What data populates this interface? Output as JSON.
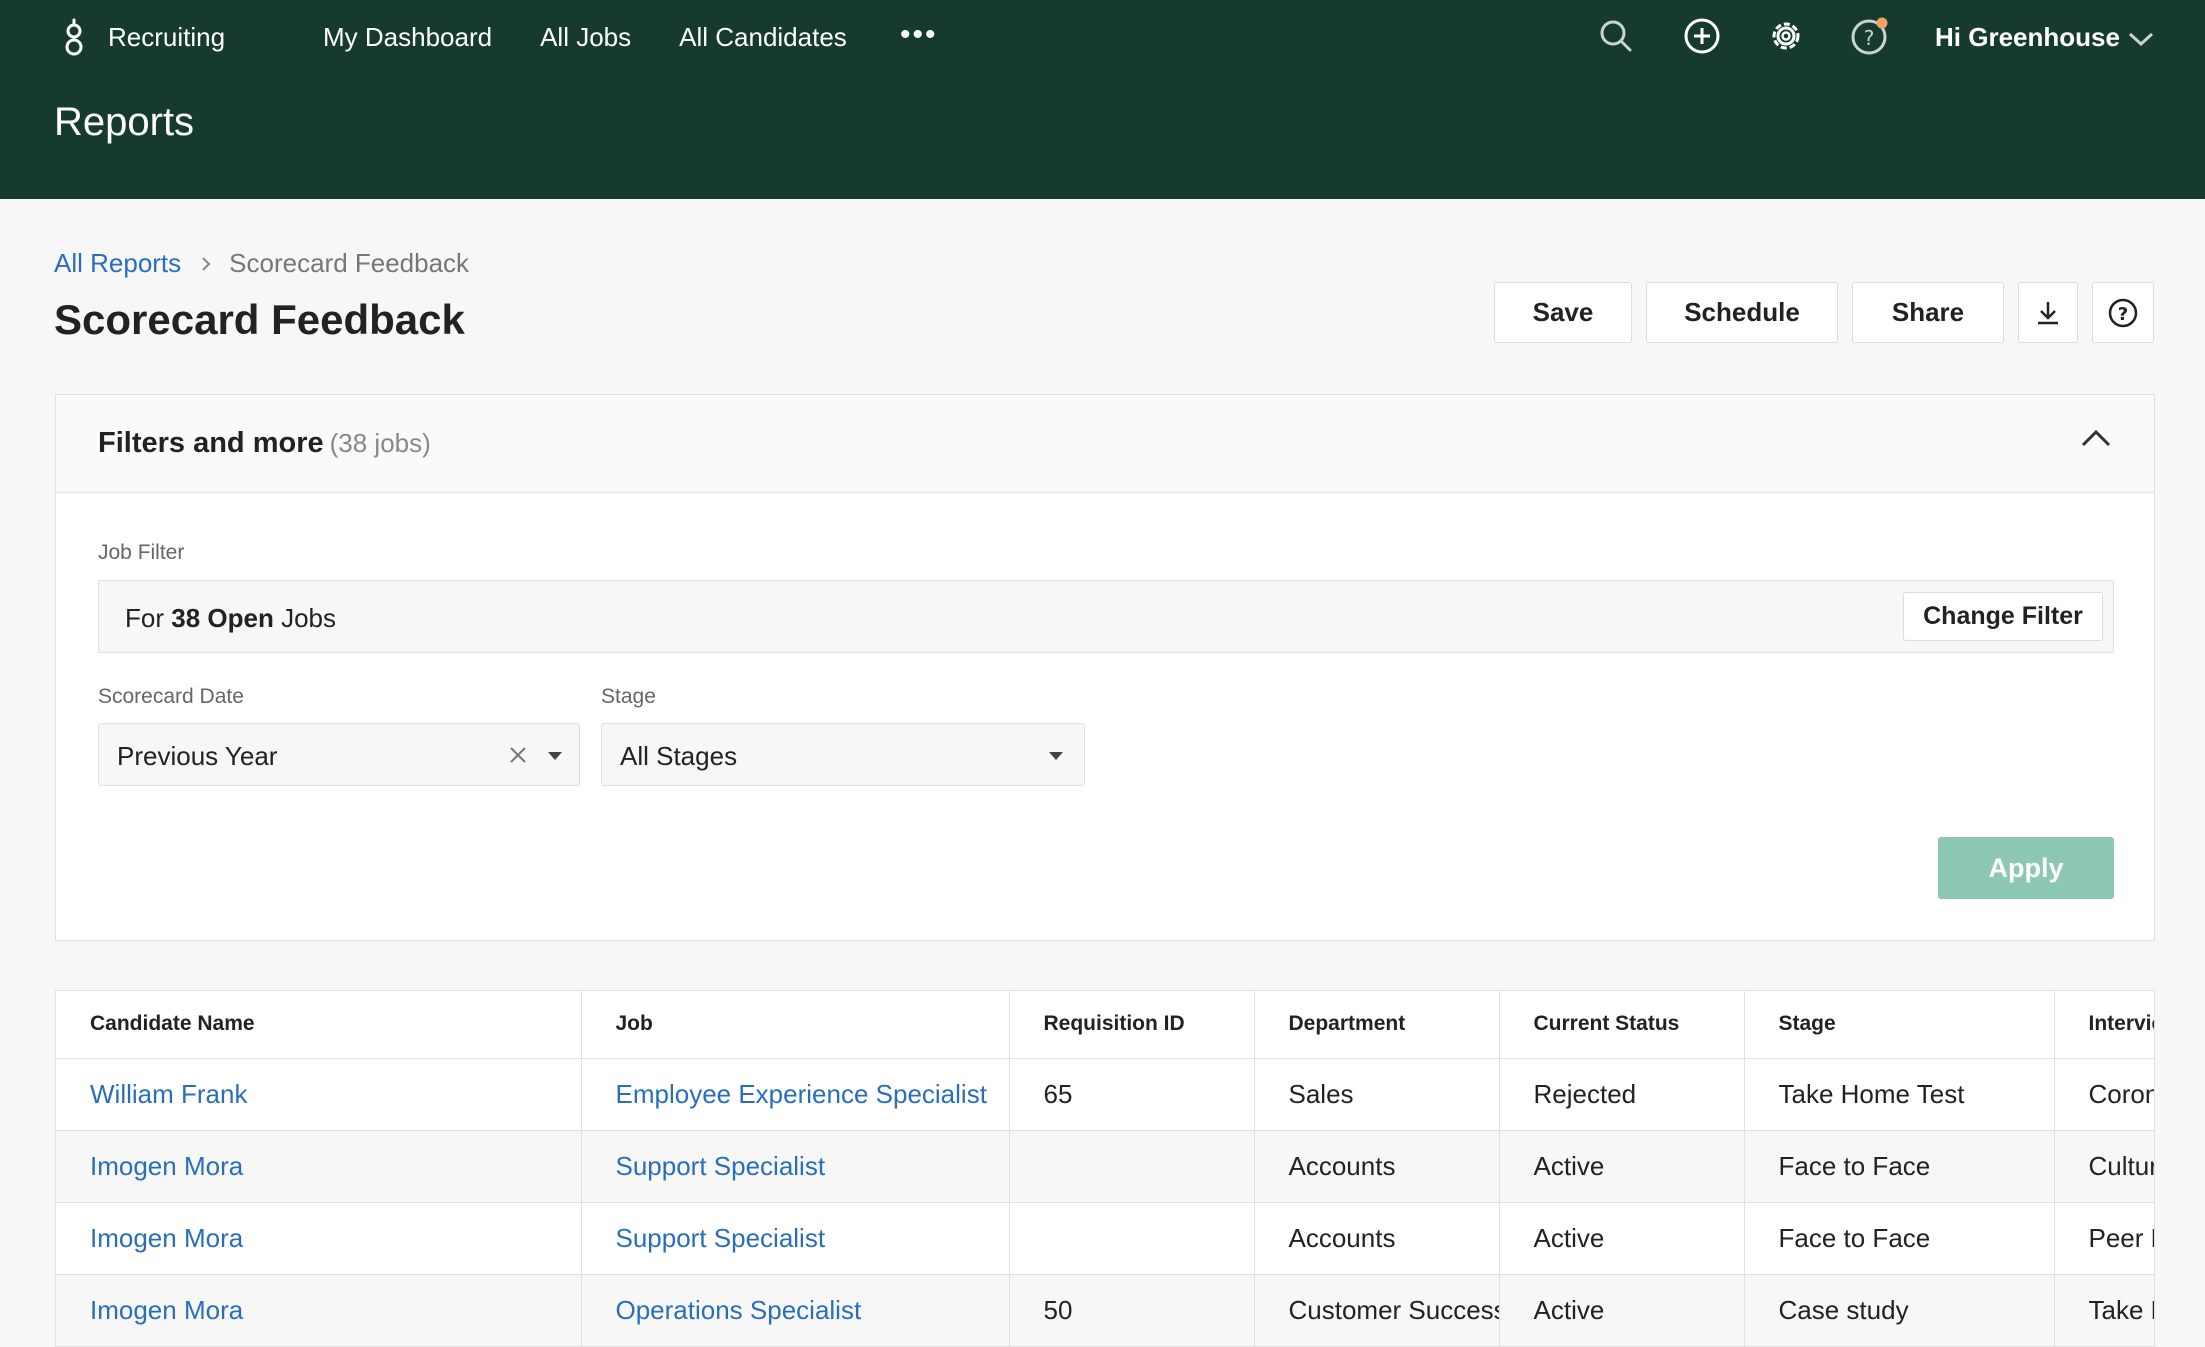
{
  "header": {
    "app_name": "Recruiting",
    "nav": [
      "My Dashboard",
      "All Jobs",
      "All Candidates"
    ],
    "more_label": "•••",
    "user_greeting": "Hi Greenhouse",
    "page_heading": "Reports",
    "icons": [
      "search-icon",
      "add-icon",
      "settings-icon",
      "help-icon"
    ],
    "colors": {
      "background": "#163b2e",
      "notification_dot": "#f4a261"
    }
  },
  "breadcrumb": {
    "parent": "All Reports",
    "current": "Scorecard Feedback"
  },
  "title": "Scorecard Feedback",
  "actions": {
    "save": "Save",
    "schedule": "Schedule",
    "share": "Share"
  },
  "filters": {
    "title": "Filters and more",
    "count": "(38 jobs)",
    "job_filter_label": "Job Filter",
    "job_filter_prefix": "For",
    "job_filter_bold": "38 Open",
    "job_filter_suffix": "Jobs",
    "change_filter": "Change Filter",
    "scorecard_date_label": "Scorecard Date",
    "scorecard_date_value": "Previous Year",
    "stage_label": "Stage",
    "stage_value": "All Stages",
    "apply": "Apply"
  },
  "table": {
    "columns": [
      "Candidate Name",
      "Job",
      "Requisition ID",
      "Department",
      "Current Status",
      "Stage",
      "Interview"
    ],
    "rows": [
      [
        "William Frank",
        "Employee Experience Specialist",
        "65",
        "Sales",
        "Rejected",
        "Take Home Test",
        "Coronavirus"
      ],
      [
        "Imogen Mora",
        "Support Specialist",
        "",
        "Accounts",
        "Active",
        "Face to Face",
        "Culture"
      ],
      [
        "Imogen Mora",
        "Support Specialist",
        "",
        "Accounts",
        "Active",
        "Face to Face",
        "Peer Review"
      ],
      [
        "Imogen Mora",
        "Operations Specialist",
        "50",
        "Customer Success",
        "Active",
        "Case study",
        "Take Home"
      ]
    ]
  }
}
